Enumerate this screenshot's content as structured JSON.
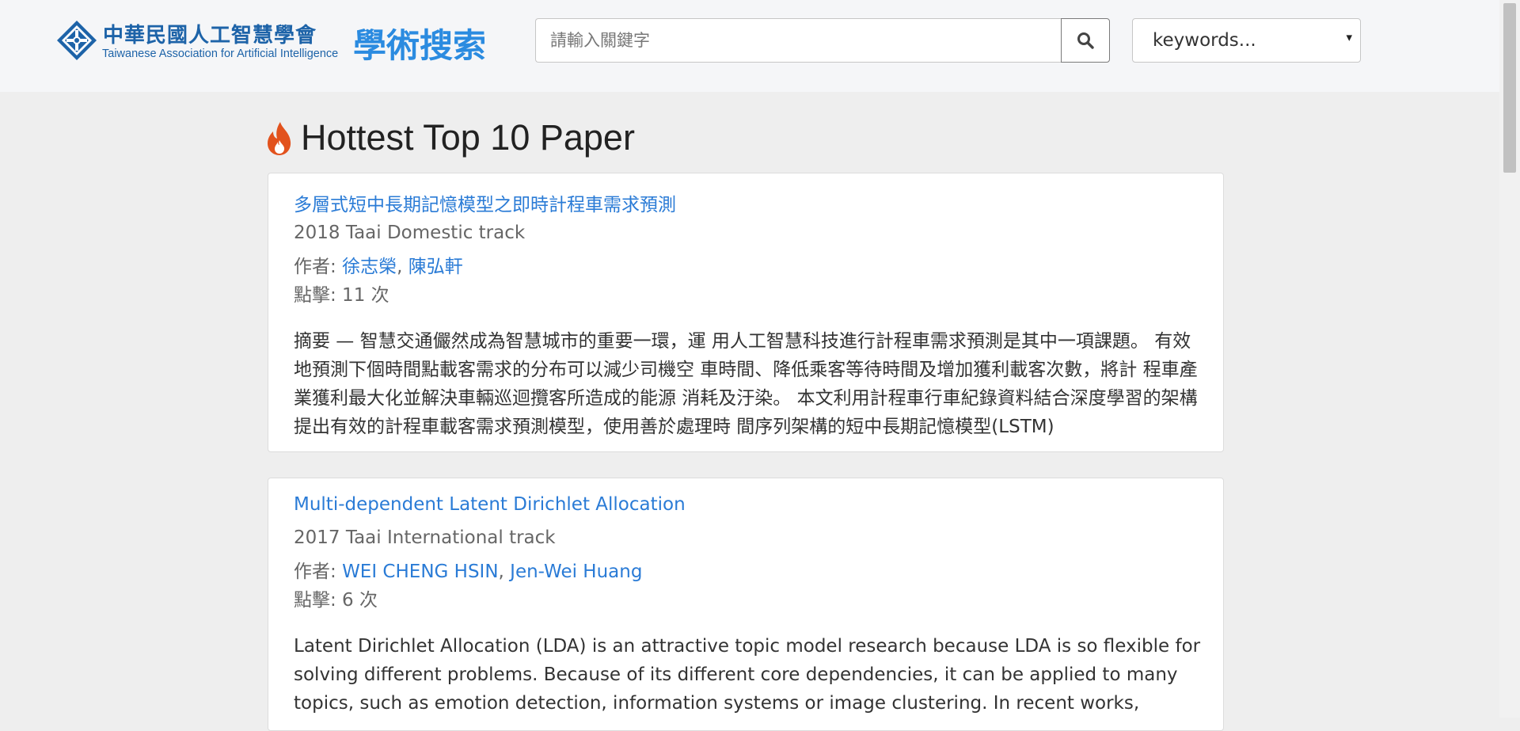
{
  "header": {
    "logo_zh": "中華民國人工智慧學會",
    "logo_en": "Taiwanese Association for Artificial Intelligence",
    "site_title": "學術搜索",
    "search_placeholder": "請輸入關鍵字",
    "search_icon": "search-icon",
    "select_value": "keywords...",
    "select_arrow": "▾"
  },
  "section": {
    "icon": "fire-icon",
    "title": "Hottest Top 10 Paper"
  },
  "papers": [
    {
      "title": "多層式短中長期記憶模型之即時計程車需求預測",
      "track": "2018 Taai Domestic track",
      "authors_label": "作者: ",
      "authors": [
        "徐志榮",
        "陳弘軒"
      ],
      "clicks": "點擊: 11 次",
      "abstract": "摘要 — 智慧交通儼然成為智慧城市的重要一環，運 用人工智慧科技進行計程車需求預測是其中一項課題。 有效地預測下個時間點載客需求的分布可以減少司機空 車時間、降低乘客等待時間及增加獲利載客次數，將計 程車產業獲利最大化並解決車輛巡迴攬客所造成的能源 消耗及汙染。 本文利用計程車行車紀錄資料結合深度學習的架構 提出有效的計程車載客需求預測模型，使用善於處理時 間序列架構的短中長期記憶模型(LSTM)"
    },
    {
      "title": "Multi-dependent Latent Dirichlet Allocation",
      "track": "2017 Taai International track",
      "authors_label": "作者: ",
      "authors": [
        "WEI CHENG HSIN",
        "Jen-Wei Huang"
      ],
      "clicks": "點擊: 6 次",
      "abstract": "Latent Dirichlet Allocation (LDA) is an attractive topic model research because LDA is so flexible for solving different problems. Because of its different core dependencies, it can be applied to many topics, such as emotion detection, information systems or image clustering. In recent works,"
    }
  ],
  "colors": {
    "brand_blue": "#1d63a8",
    "title_blue": "#2b8be0",
    "link_blue": "#2a7bd6",
    "fire_orange": "#e2521d"
  }
}
